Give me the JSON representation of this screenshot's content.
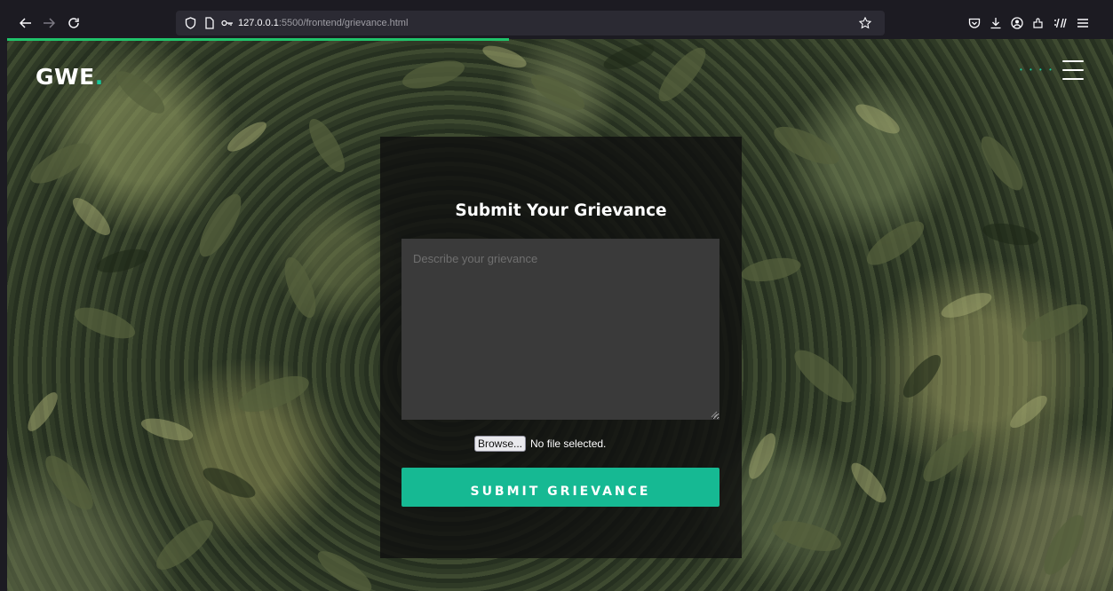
{
  "browser": {
    "url_host": "127.0.0.1",
    "url_path": ":5500/frontend/grievance.html",
    "icons": {
      "back": "arrow-left-icon",
      "forward": "arrow-right-icon",
      "reload": "reload-icon",
      "shield": "tracking-shield-icon",
      "page": "page-icon",
      "permissions": "key-icon",
      "bookmark": "star-icon",
      "pocket": "pocket-icon",
      "downloads": "download-icon",
      "account": "account-icon",
      "extensions": "extensions-icon",
      "devtools": "devtools-icon",
      "menu": "app-menu-icon"
    }
  },
  "page": {
    "logo_text": "GWE",
    "logo_dot": ".",
    "nav_dots": "• • • •",
    "accent_color": "#16c79a"
  },
  "form": {
    "title": "Submit Your Grievance",
    "grievance_placeholder": "Describe your grievance",
    "browse_label": "Browse...",
    "file_status": "No file selected.",
    "submit_label": "SUBMIT GRIEVANCE",
    "submit_color": "#16b993"
  }
}
